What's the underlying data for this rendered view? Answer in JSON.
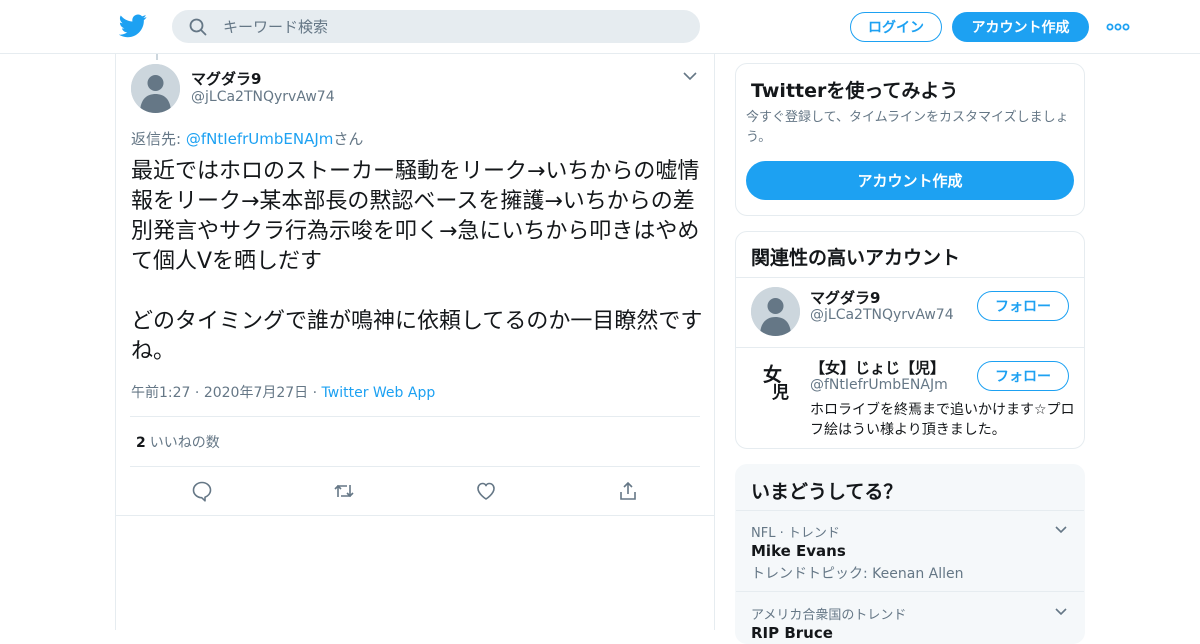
{
  "header": {
    "logo_icon": "twitter-bird-icon",
    "search_placeholder": "キーワード検索",
    "login_label": "ログイン",
    "signup_label": "アカウント作成",
    "brand_color": "#1da1f2"
  },
  "tweet": {
    "display_name": "マグダラ9",
    "handle": "@jLCa2TNQyrvAw74",
    "reply_prefix": "返信先: ",
    "reply_handle": "@fNtIefrUmbENAJm",
    "reply_suffix": "さん",
    "body": "最近ではホロのストーカー騒動をリーク→いちからの嘘情報をリーク→某本部長の黙認ベースを擁護→いちからの差別発言やサクラ行為示唆を叩く→急にいちから叩きはやめて個人Vを晒しだす\n\nどのタイミングで誰が鳴神に依頼してるのか一目瞭然ですね。",
    "time": "午前1:27",
    "date": "2020年7月27日",
    "app": "Twitter Web App",
    "like_count": "2",
    "like_label": "いいねの数",
    "actions": [
      "reply-icon",
      "retweet-icon",
      "like-icon",
      "share-icon"
    ]
  },
  "signup_card": {
    "title": "Twitterを使ってみよう",
    "description": "今すぐ登録して、タイムラインをカスタマイズしましょう。",
    "button": "アカウント作成"
  },
  "related": {
    "title": "関連性の高いアカウント",
    "accounts": [
      {
        "name": "マグダラ9",
        "handle": "@jLCa2TNQyrvAw74",
        "bio": "",
        "follow_label": "フォロー"
      },
      {
        "name": "【女】じょじ【児】",
        "handle": "@fNtIefrUmbENAJm",
        "bio": "ホロライブを終焉まで追いかけます☆プロフ絵はうい様より頂きました。",
        "follow_label": "フォロー",
        "avatar_glyph": "女児"
      }
    ]
  },
  "trends": {
    "title": "いまどうしてる？",
    "items": [
      {
        "meta": "NFL · トレンド",
        "name": "Mike Evans",
        "sub": "トレンドトピック: Keenan Allen"
      },
      {
        "meta": "アメリカ合衆国のトレンド",
        "name": "RIP Bruce",
        "sub": ""
      }
    ]
  }
}
